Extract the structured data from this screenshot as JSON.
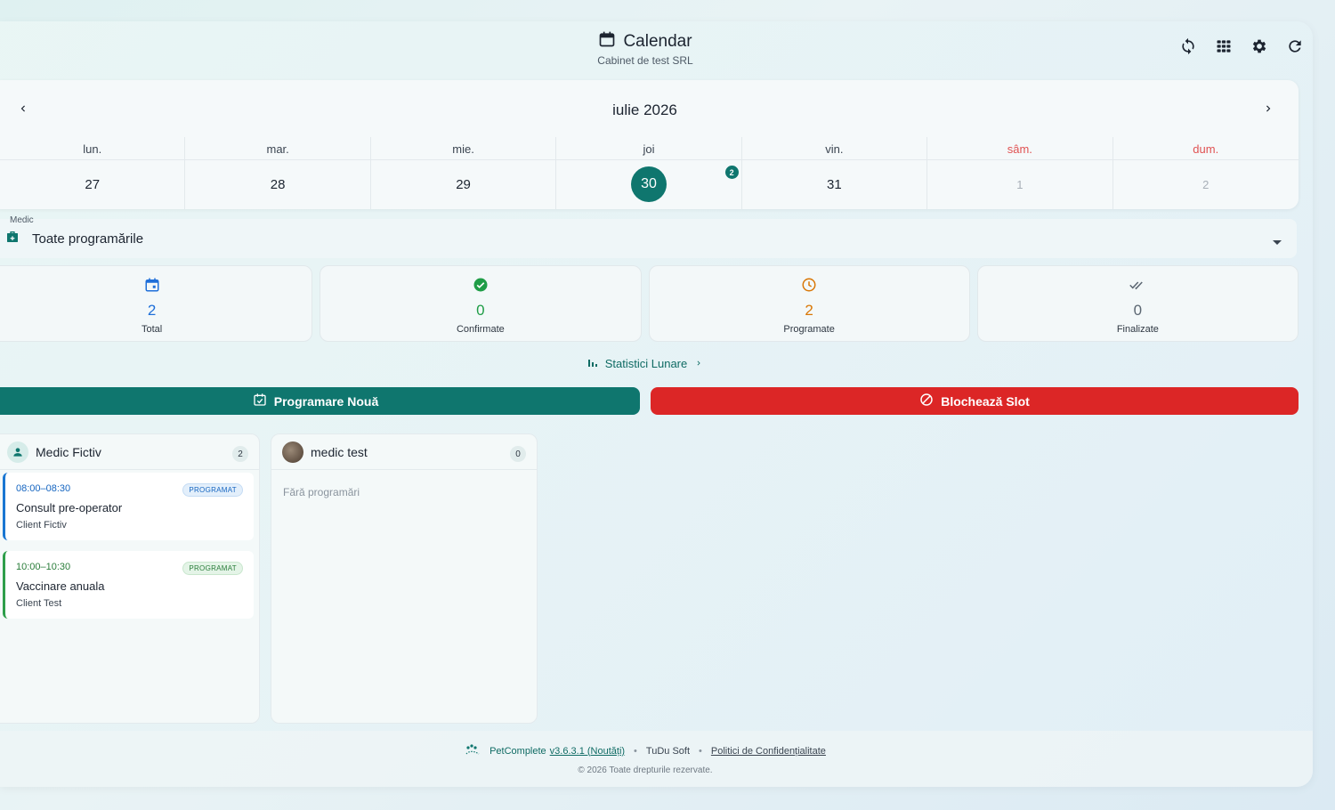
{
  "header": {
    "title": "Calendar",
    "subtitle": "Cabinet de test SRL",
    "icons": [
      "sync-icon",
      "apps-grid-icon",
      "gear-icon",
      "refresh-icon"
    ]
  },
  "calendar": {
    "month_label": "iulie 2026",
    "days": [
      {
        "name": "lun.",
        "num": "27"
      },
      {
        "name": "mar.",
        "num": "28"
      },
      {
        "name": "mie.",
        "num": "29"
      },
      {
        "name": "joi",
        "num": "30",
        "badge": "2"
      },
      {
        "name": "vin.",
        "num": "31"
      },
      {
        "name": "sâm.",
        "num": "1"
      },
      {
        "name": "dum.",
        "num": "2"
      }
    ]
  },
  "medic_filter": {
    "label": "Medic",
    "value": "Toate programările"
  },
  "stats": [
    {
      "value": "2",
      "label": "Total",
      "color": "#1e6fd9"
    },
    {
      "value": "0",
      "label": "Confirmate",
      "color": "#1f9d47"
    },
    {
      "value": "2",
      "label": "Programate",
      "color": "#d97706"
    },
    {
      "value": "0",
      "label": "Finalizate",
      "color": "#5b6672"
    }
  ],
  "monthly_stats_link": "Statistici Lunare",
  "actions": {
    "new_appointment": "Programare Nouă",
    "block_slot": "Blochează Slot"
  },
  "doctors": [
    {
      "name": "Medic Fictiv",
      "count": "2",
      "appointments": [
        {
          "time": "08:00–08:30",
          "status": "PROGRAMAT",
          "title": "Consult pre-operator",
          "client": "Client Fictiv"
        },
        {
          "time": "10:00–10:30",
          "status": "PROGRAMAT",
          "title": "Vaccinare anuala",
          "client": "Client Test"
        }
      ]
    },
    {
      "name": "medic test",
      "count": "0",
      "empty": "Fără programări"
    }
  ],
  "footer": {
    "brand": "PetComplete",
    "version": "v3.6.3.1 (Noutăți)",
    "company": "TuDu Soft",
    "policy": "Politici de Confidențialitate",
    "copyright": "© 2026 Toate drepturile rezervate."
  },
  "colors": {
    "primary": "#0f766e",
    "danger": "#dc2626",
    "weekend": "#e05252"
  }
}
